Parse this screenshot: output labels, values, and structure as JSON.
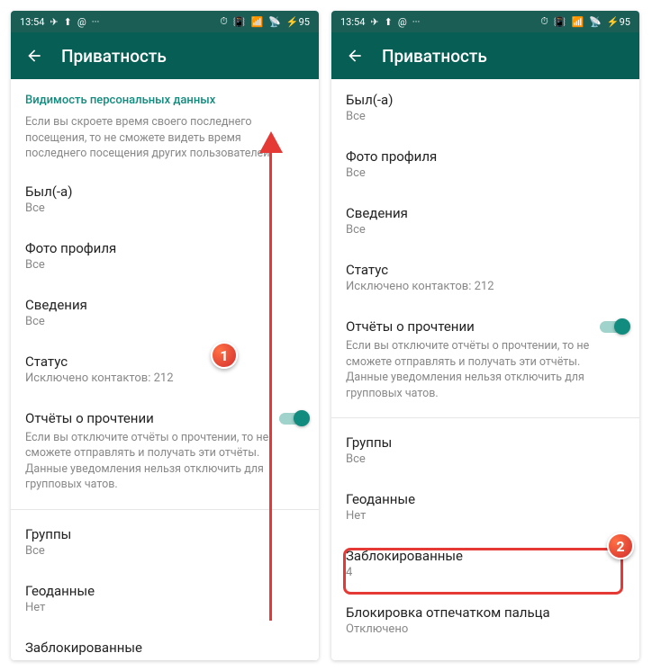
{
  "statusbar": {
    "time": "13:54",
    "battery": "95"
  },
  "colors": {
    "primary": "#075E54",
    "accent": "#128C7E"
  },
  "header": {
    "title": "Приватность"
  },
  "section": {
    "title": "Видимость персональных данных",
    "desc": "Если вы скроете время своего последнего посещения, то не сможете видеть время последнего посещения других пользователей."
  },
  "items": {
    "last_seen": {
      "title": "Был(-а)",
      "value": "Все"
    },
    "photo": {
      "title": "Фото профиля",
      "value": "Все"
    },
    "about": {
      "title": "Сведения",
      "value": "Все"
    },
    "status": {
      "title": "Статус",
      "value": "Исключено контактов: 212"
    },
    "read_receipts": {
      "title": "Отчёты о прочтении",
      "desc": "Если вы отключите отчёты о прочтении, то не сможете отправлять и получать эти отчёты. Данные уведомления нельзя отключить для групповых чатов."
    },
    "groups": {
      "title": "Группы",
      "value": "Все"
    },
    "geo": {
      "title": "Геоданные",
      "value": "Нет"
    },
    "blocked": {
      "title": "Заблокированные",
      "value": "4"
    },
    "fingerprint": {
      "title": "Блокировка отпечатком пальца",
      "value": "Отключено"
    }
  },
  "annotations": {
    "badge1": "1",
    "badge2": "2"
  }
}
